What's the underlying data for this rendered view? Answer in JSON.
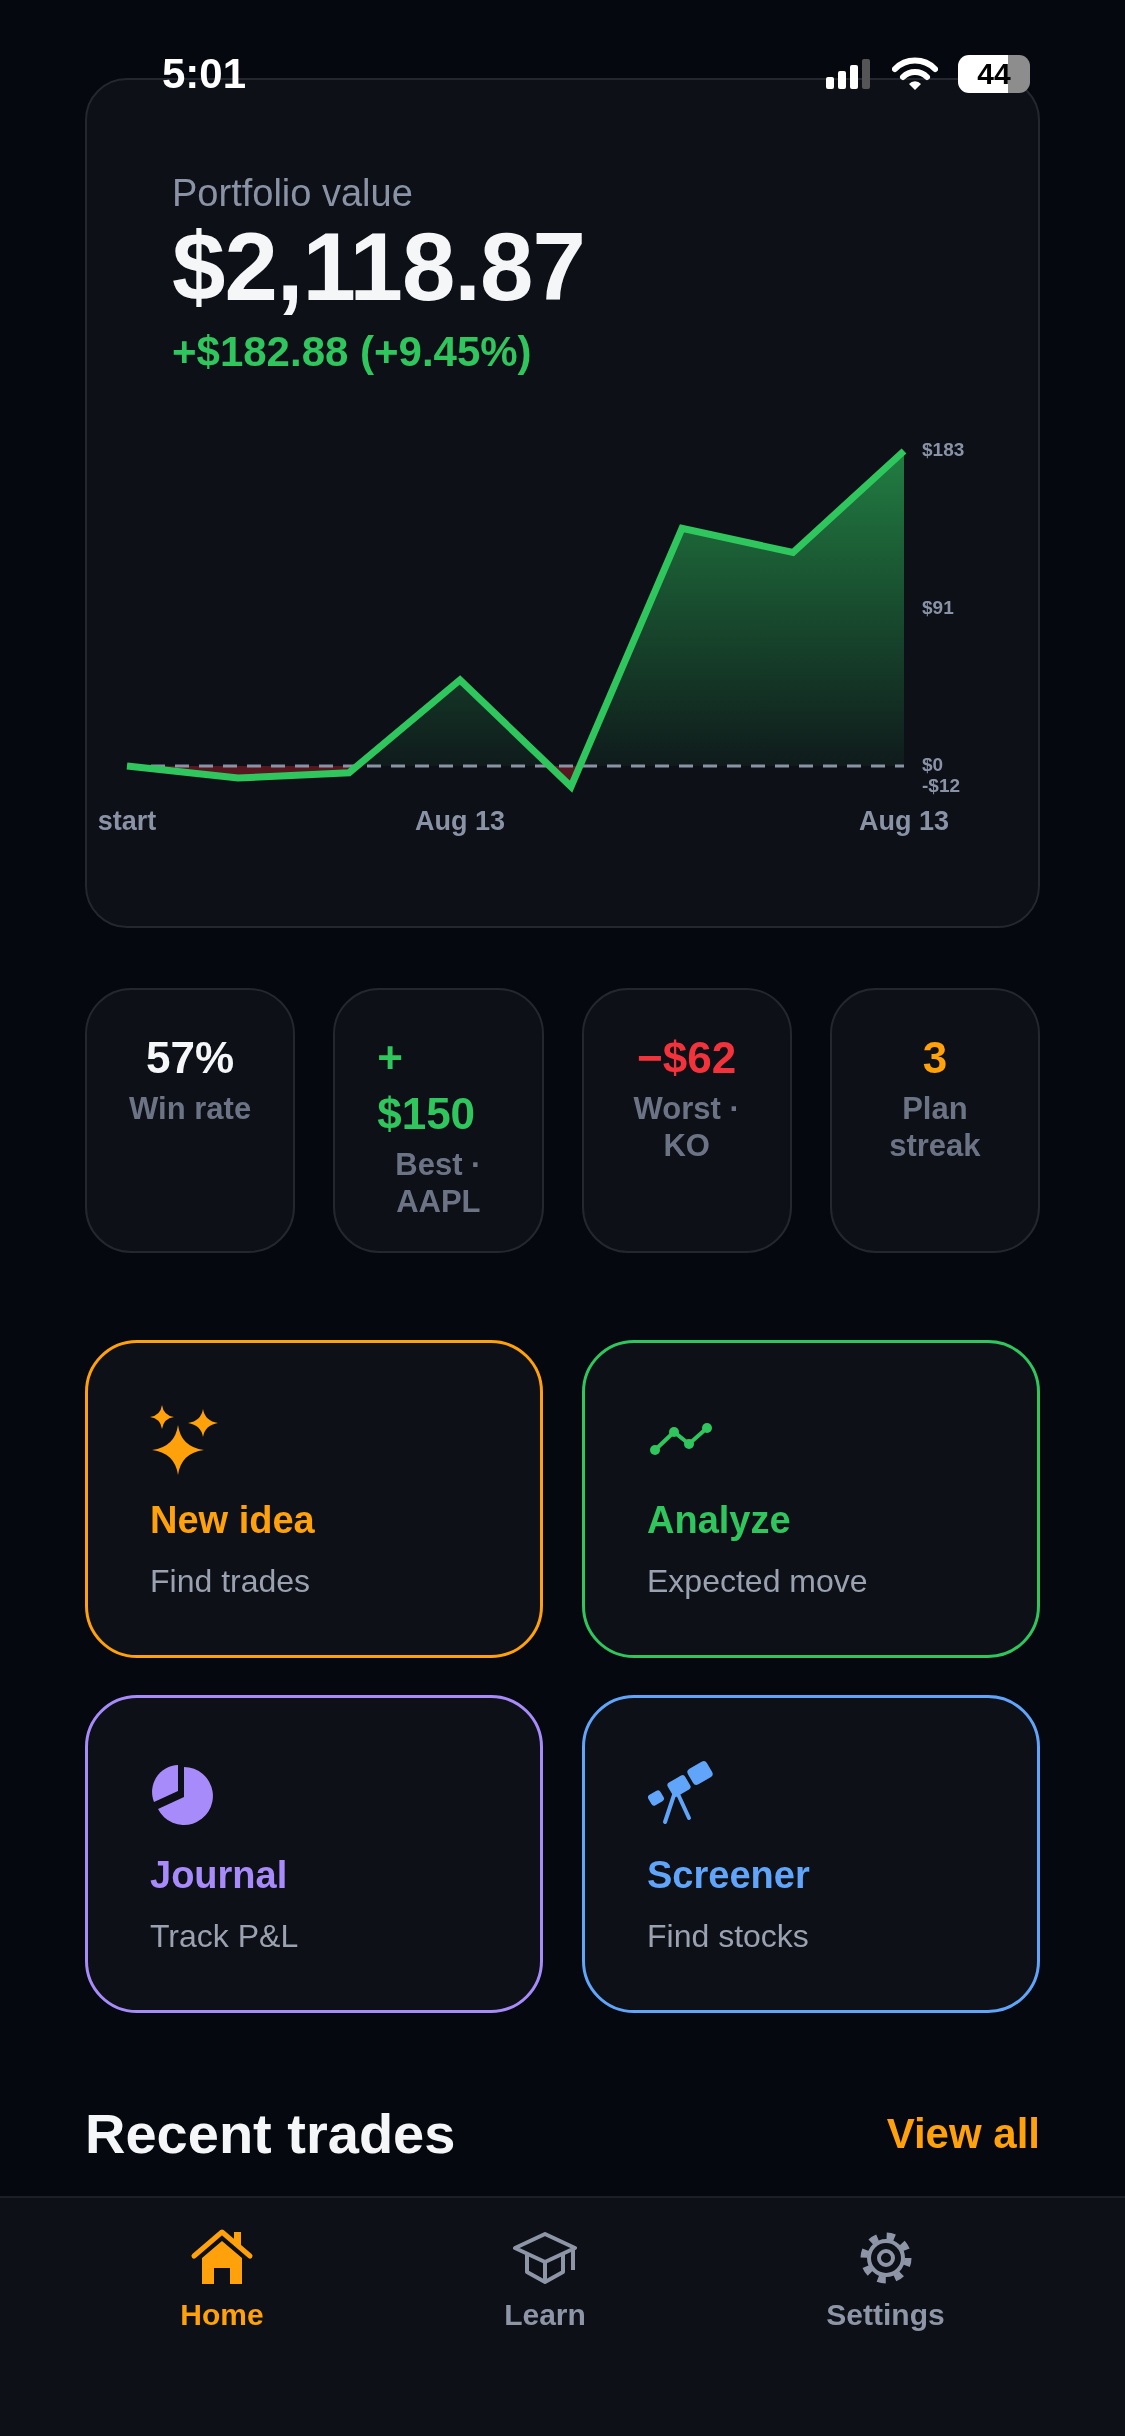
{
  "status_bar": {
    "time": "5:01",
    "battery": "44"
  },
  "portfolio": {
    "label": "Portfolio value",
    "value": "$2,118.87",
    "change": "+$182.88 (+9.45%)",
    "chart_data": {
      "type": "area",
      "categories": [
        "start",
        null,
        null,
        "Aug 13",
        null,
        null,
        null,
        "Aug 13"
      ],
      "series": [
        {
          "color": "#2fc65e",
          "values": [
            0,
            -7,
            -4,
            50,
            -12,
            138,
            124,
            183
          ]
        }
      ],
      "ylim": [
        -12,
        183
      ],
      "yticks": [
        {
          "value": 183,
          "label": "$183"
        },
        {
          "value": 91,
          "label": "$91"
        },
        {
          "value": 0,
          "label": "$0"
        },
        {
          "value": -12,
          "label": "-$12"
        }
      ]
    }
  },
  "stats": [
    {
      "value": "57%",
      "label": "Win rate",
      "color": "#f5f6f8"
    },
    {
      "value": "+ $150",
      "label": "Best · AAPL",
      "color": "#2fc65e"
    },
    {
      "value": "−$62",
      "label": "Worst · KO",
      "color": "#f4323c"
    },
    {
      "value": "3",
      "label": "Plan streak",
      "color": "#ffa10a"
    }
  ],
  "actions": [
    {
      "title": "New idea",
      "subtitle": "Find trades",
      "color": "#ffa10a"
    },
    {
      "title": "Analyze",
      "subtitle": "Expected move",
      "color": "#2fc65e"
    },
    {
      "title": "Journal",
      "subtitle": "Track P&L",
      "color": "#a78bfa"
    },
    {
      "title": "Screener",
      "subtitle": "Find stocks",
      "color": "#60a5fa"
    }
  ],
  "recent": {
    "title": "Recent trades",
    "link": "View all"
  },
  "nav": [
    {
      "label": "Home",
      "selected": true
    },
    {
      "label": "Learn",
      "selected": false
    },
    {
      "label": "Settings",
      "selected": false
    }
  ]
}
